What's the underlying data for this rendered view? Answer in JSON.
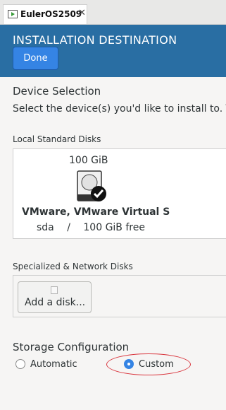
{
  "tab": {
    "label": "EulerOS2509",
    "close": "✕"
  },
  "header": {
    "title": "INSTALLATION DESTINATION",
    "done_label": "Done"
  },
  "device_selection": {
    "title": "Device Selection",
    "description": "Select the device(s) you'd like to install to.  T"
  },
  "local_disks": {
    "label": "Local Standard Disks",
    "disk": {
      "size": "100 GiB",
      "name": "VMware, VMware Virtual S",
      "device": "sda",
      "separator": "/",
      "free": "100 GiB free"
    }
  },
  "network_disks": {
    "label": "Specialized & Network Disks",
    "add_label": "Add a disk..."
  },
  "storage": {
    "title": "Storage Configuration",
    "automatic_label": "Automatic",
    "custom_label": "Custom",
    "selected": "Custom"
  },
  "colors": {
    "header": "#296ea3",
    "accent": "#3584e4",
    "highlight": "#d9363e"
  }
}
